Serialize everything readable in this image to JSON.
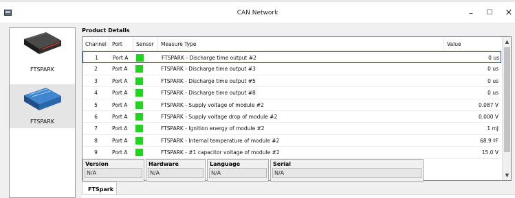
{
  "window": {
    "title": "CAN Network",
    "minimize": "–",
    "maximize": "☐",
    "close": "×"
  },
  "devices": [
    {
      "name": "FTSPARK",
      "color": "#2b2b2b"
    },
    {
      "name": "FTSPARK",
      "color": "#2a6fb6"
    }
  ],
  "details": {
    "title": "Product Details",
    "columns": [
      "Channel",
      "Port",
      "Sensor",
      "Measure Type",
      "Value"
    ],
    "rows": [
      {
        "channel": "1",
        "port": "Port A",
        "measure": "FTSPARK - Discharge time output #2",
        "value": "0 us"
      },
      {
        "channel": "2",
        "port": "Port A",
        "measure": "FTSPARK - Discharge time output #3",
        "value": "0 us"
      },
      {
        "channel": "3",
        "port": "Port A",
        "measure": "FTSPARK - Discharge time output #5",
        "value": "0 us"
      },
      {
        "channel": "4",
        "port": "Port A",
        "measure": "FTSPARK - Discharge time output #8",
        "value": "0 us"
      },
      {
        "channel": "5",
        "port": "Port A",
        "measure": "FTSPARK - Supply voltage of module #2",
        "value": "0.087 V"
      },
      {
        "channel": "6",
        "port": "Port A",
        "measure": "FTSPARK - Supply voltage drop of module #2",
        "value": "0.000 V"
      },
      {
        "channel": "7",
        "port": "Port A",
        "measure": "FTSPARK - Ignition energy of module #2",
        "value": "1 mJ"
      },
      {
        "channel": "8",
        "port": "Port A",
        "measure": "FTSPARK - Internal temperature of module #2",
        "value": "68.9 ºF"
      },
      {
        "channel": "9",
        "port": "Port A",
        "measure": "FTSPARK - #1 capacitor voltage of module #2",
        "value": "15.0 V"
      }
    ],
    "sensor_color": "#1ed61e",
    "selected_row": 0
  },
  "info": {
    "version": {
      "label": "Version",
      "value": "N/A"
    },
    "hardware": {
      "label": "Hardware",
      "value": "N/A"
    },
    "language": {
      "label": "Language",
      "value": "N/A"
    },
    "serial": {
      "label": "Serial",
      "value": "N/A"
    }
  },
  "tabs": [
    {
      "label": "FTSpark",
      "active": true
    }
  ]
}
